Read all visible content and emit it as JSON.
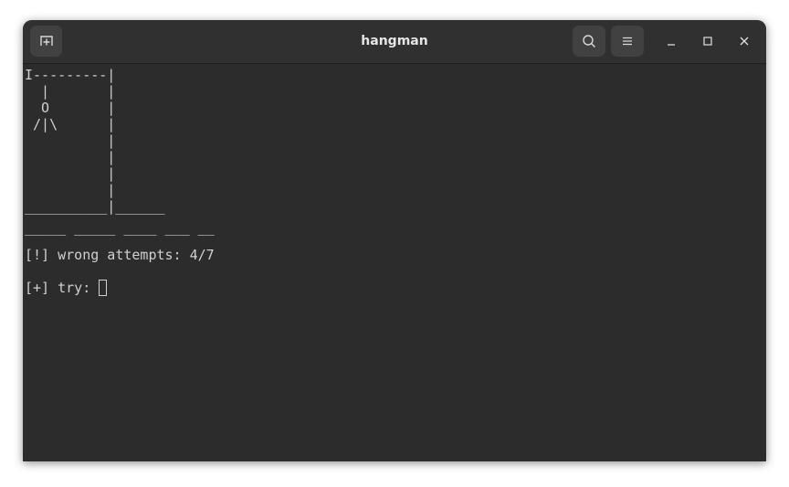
{
  "window": {
    "title": "hangman"
  },
  "header": {
    "icons": {
      "new_tab": "new-tab-icon",
      "search": "search-icon",
      "menu": "hamburger-menu-icon",
      "minimize": "minimize-icon",
      "maximize": "maximize-icon",
      "close": "close-icon"
    }
  },
  "terminal": {
    "gallows": "I---------|\n  |       |\n  O       |\n /|\\      |\n          |\n          |\n          |\n          |\n__________|______",
    "word_blanks": "_____ _____ ____ ___ __",
    "status": "[!] wrong attempts: 4/7",
    "prompt": "[+] try:",
    "input_value": ""
  },
  "colors": {
    "background": "#2c2c2c",
    "titlebar": "#303030",
    "button": "#414141",
    "text": "#d0d0d0",
    "title_text": "#e6e6e6"
  }
}
